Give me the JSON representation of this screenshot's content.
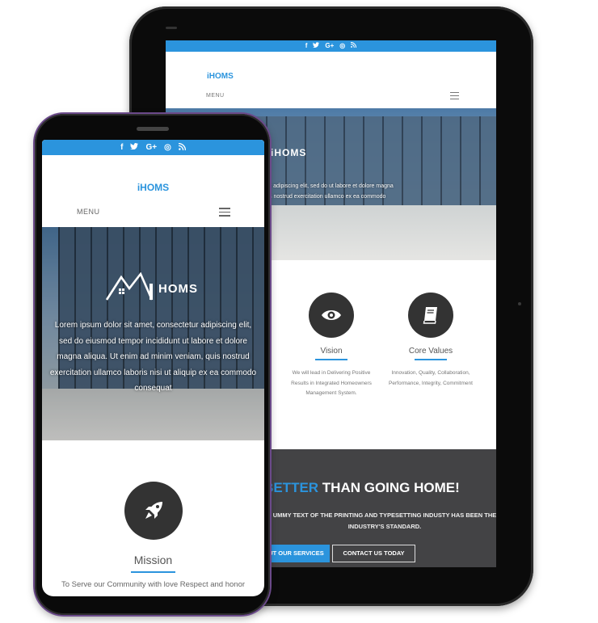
{
  "social_icons": [
    "f",
    "t",
    "G+",
    "◎",
    "rss"
  ],
  "brand": {
    "prefix": "i",
    "name": "HOMS"
  },
  "tablet": {
    "menu_label": "MENU",
    "hero_text": "consectetur adipiscing elit, sed do ut labore et dolore magna aliqua. Ut is nostrud exercitation ullamco ex ea commodo consequat",
    "features": [
      {
        "title": "Vision",
        "icon": "eye-icon",
        "description": "We will lead in Delivering Positive Results in Integrated Homeowners Management System."
      },
      {
        "title": "Core Values",
        "icon": "book-icon",
        "description": "Innovation, Quality, Collaboration, Performance, Integrity, Commitment"
      }
    ],
    "banner": {
      "headline_pre": "S ",
      "headline_blue": "BETTER",
      "headline_post": " THAN GOING HOME!",
      "subtext": "UMMY TEXT OF THE PRINTING AND TYPESETTING INDUSTY HAS BEEN THE INDUSTRY'S STANDARD.",
      "button_services": "UT OUR SERVICES",
      "button_contact": "CONTACT US TODAY"
    }
  },
  "phone": {
    "menu_label": "MENU",
    "hero_text": "Lorem ipsum dolor sit amet, consectetur adipiscing elit, sed do eiusmod tempor incididunt ut labore et dolore magna aliqua. Ut enim ad minim veniam, quis nostrud exercitation ullamco laboris nisi ut aliquip ex ea commodo consequat",
    "mission": {
      "title": "Mission",
      "icon": "rocket-icon",
      "description": "To Serve our Community with love Respect and honor"
    }
  },
  "colors": {
    "accent": "#2b94dd",
    "dark": "#434345",
    "icon_circle": "#333333"
  }
}
